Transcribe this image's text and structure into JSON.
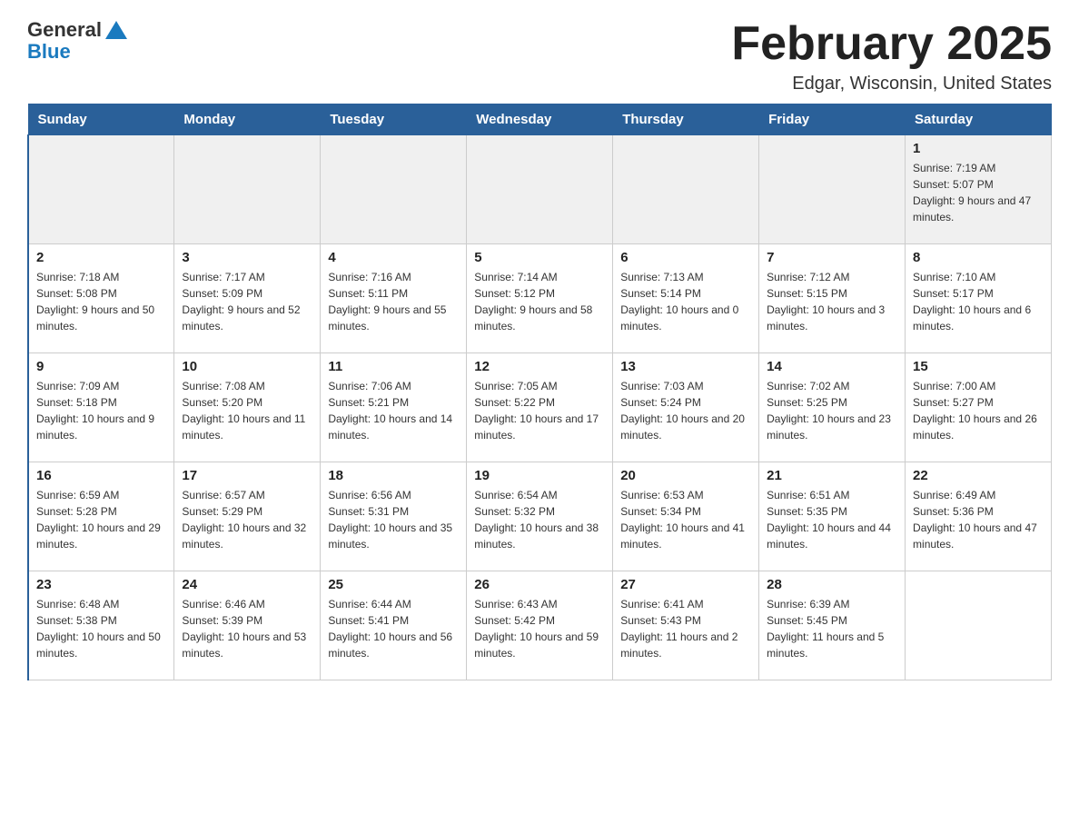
{
  "header": {
    "logo_general": "General",
    "logo_blue": "Blue",
    "title": "February 2025",
    "subtitle": "Edgar, Wisconsin, United States"
  },
  "weekdays": [
    "Sunday",
    "Monday",
    "Tuesday",
    "Wednesday",
    "Thursday",
    "Friday",
    "Saturday"
  ],
  "weeks": [
    [
      {
        "day": "",
        "info": ""
      },
      {
        "day": "",
        "info": ""
      },
      {
        "day": "",
        "info": ""
      },
      {
        "day": "",
        "info": ""
      },
      {
        "day": "",
        "info": ""
      },
      {
        "day": "",
        "info": ""
      },
      {
        "day": "1",
        "info": "Sunrise: 7:19 AM\nSunset: 5:07 PM\nDaylight: 9 hours and 47 minutes."
      }
    ],
    [
      {
        "day": "2",
        "info": "Sunrise: 7:18 AM\nSunset: 5:08 PM\nDaylight: 9 hours and 50 minutes."
      },
      {
        "day": "3",
        "info": "Sunrise: 7:17 AM\nSunset: 5:09 PM\nDaylight: 9 hours and 52 minutes."
      },
      {
        "day": "4",
        "info": "Sunrise: 7:16 AM\nSunset: 5:11 PM\nDaylight: 9 hours and 55 minutes."
      },
      {
        "day": "5",
        "info": "Sunrise: 7:14 AM\nSunset: 5:12 PM\nDaylight: 9 hours and 58 minutes."
      },
      {
        "day": "6",
        "info": "Sunrise: 7:13 AM\nSunset: 5:14 PM\nDaylight: 10 hours and 0 minutes."
      },
      {
        "day": "7",
        "info": "Sunrise: 7:12 AM\nSunset: 5:15 PM\nDaylight: 10 hours and 3 minutes."
      },
      {
        "day": "8",
        "info": "Sunrise: 7:10 AM\nSunset: 5:17 PM\nDaylight: 10 hours and 6 minutes."
      }
    ],
    [
      {
        "day": "9",
        "info": "Sunrise: 7:09 AM\nSunset: 5:18 PM\nDaylight: 10 hours and 9 minutes."
      },
      {
        "day": "10",
        "info": "Sunrise: 7:08 AM\nSunset: 5:20 PM\nDaylight: 10 hours and 11 minutes."
      },
      {
        "day": "11",
        "info": "Sunrise: 7:06 AM\nSunset: 5:21 PM\nDaylight: 10 hours and 14 minutes."
      },
      {
        "day": "12",
        "info": "Sunrise: 7:05 AM\nSunset: 5:22 PM\nDaylight: 10 hours and 17 minutes."
      },
      {
        "day": "13",
        "info": "Sunrise: 7:03 AM\nSunset: 5:24 PM\nDaylight: 10 hours and 20 minutes."
      },
      {
        "day": "14",
        "info": "Sunrise: 7:02 AM\nSunset: 5:25 PM\nDaylight: 10 hours and 23 minutes."
      },
      {
        "day": "15",
        "info": "Sunrise: 7:00 AM\nSunset: 5:27 PM\nDaylight: 10 hours and 26 minutes."
      }
    ],
    [
      {
        "day": "16",
        "info": "Sunrise: 6:59 AM\nSunset: 5:28 PM\nDaylight: 10 hours and 29 minutes."
      },
      {
        "day": "17",
        "info": "Sunrise: 6:57 AM\nSunset: 5:29 PM\nDaylight: 10 hours and 32 minutes."
      },
      {
        "day": "18",
        "info": "Sunrise: 6:56 AM\nSunset: 5:31 PM\nDaylight: 10 hours and 35 minutes."
      },
      {
        "day": "19",
        "info": "Sunrise: 6:54 AM\nSunset: 5:32 PM\nDaylight: 10 hours and 38 minutes."
      },
      {
        "day": "20",
        "info": "Sunrise: 6:53 AM\nSunset: 5:34 PM\nDaylight: 10 hours and 41 minutes."
      },
      {
        "day": "21",
        "info": "Sunrise: 6:51 AM\nSunset: 5:35 PM\nDaylight: 10 hours and 44 minutes."
      },
      {
        "day": "22",
        "info": "Sunrise: 6:49 AM\nSunset: 5:36 PM\nDaylight: 10 hours and 47 minutes."
      }
    ],
    [
      {
        "day": "23",
        "info": "Sunrise: 6:48 AM\nSunset: 5:38 PM\nDaylight: 10 hours and 50 minutes."
      },
      {
        "day": "24",
        "info": "Sunrise: 6:46 AM\nSunset: 5:39 PM\nDaylight: 10 hours and 53 minutes."
      },
      {
        "day": "25",
        "info": "Sunrise: 6:44 AM\nSunset: 5:41 PM\nDaylight: 10 hours and 56 minutes."
      },
      {
        "day": "26",
        "info": "Sunrise: 6:43 AM\nSunset: 5:42 PM\nDaylight: 10 hours and 59 minutes."
      },
      {
        "day": "27",
        "info": "Sunrise: 6:41 AM\nSunset: 5:43 PM\nDaylight: 11 hours and 2 minutes."
      },
      {
        "day": "28",
        "info": "Sunrise: 6:39 AM\nSunset: 5:45 PM\nDaylight: 11 hours and 5 minutes."
      },
      {
        "day": "",
        "info": ""
      }
    ]
  ]
}
